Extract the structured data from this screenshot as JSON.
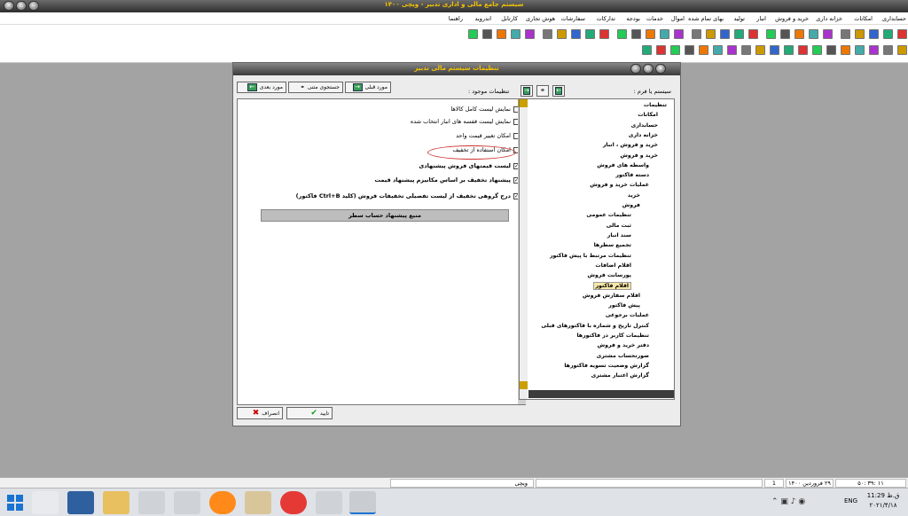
{
  "app": {
    "title": "سیستم جامع مالی و اداری تدبیر - ویچی ۱۴۰۰"
  },
  "menu": [
    "حسابداری",
    "امکانات",
    "خزانه داری",
    "خرید و فروش",
    "انبار",
    "تولید",
    "بهای تمام شده",
    "اموال",
    "خدمات",
    "بودجه",
    "تدارکات",
    "سفارشات",
    "هوش تجاری",
    "کارتابل",
    "اندروید",
    "راهنما"
  ],
  "dialog": {
    "title": "تنظیمات سیستم مالی تدبیر",
    "form_label": "سیستم یا فرم :",
    "settings_label": "تنظیمات موجود :",
    "prev_label": "مورد قبلی",
    "search_label": "جستجوی متنی",
    "next_label": "مورد بعدی",
    "options": [
      {
        "label": "نمایش لیست کامل کالاها",
        "checked": false,
        "bold": false
      },
      {
        "label": "نمایش لیست قفسه های انبار انتخاب شده",
        "checked": false,
        "bold": false
      },
      {
        "label": "امکان تغییر قیمت واحد",
        "checked": false,
        "bold": false
      },
      {
        "label": "امکان استفاده از تخفیف",
        "checked": false,
        "bold": false
      },
      {
        "label": "لیست قیمتهای فروش پیشنهادی",
        "checked": true,
        "bold": true
      },
      {
        "label": "پیشنهاد تخفیف بر اساس مکانیزم پیشنهاد قیمت",
        "checked": true,
        "bold": true
      },
      {
        "label": "درج گروهی تخفیف از لیست تفصیلی تخفیفات فروش (کلید Ctrl+B فاکتور)",
        "checked": true,
        "bold": true
      }
    ],
    "source_bar": "منبع پیشنهاد حساب سطر",
    "tree": [
      {
        "label": "تنظیمات",
        "level": 0
      },
      {
        "label": "امکانات",
        "level": 1
      },
      {
        "label": "حسابداری",
        "level": 1
      },
      {
        "label": "خزانه داری",
        "level": 1
      },
      {
        "label": "خرید و فروش ، انبار",
        "level": 1
      },
      {
        "label": "خرید و فروش",
        "level": 1
      },
      {
        "label": "واسطه های فروش",
        "level": 2
      },
      {
        "label": "دسته فاکتور",
        "level": 2
      },
      {
        "label": "عملیات خرید و فروش",
        "level": 2
      },
      {
        "label": "خرید",
        "level": 3
      },
      {
        "label": "فروش",
        "level": 3
      },
      {
        "label": "تنظیمات عمومی",
        "level": 4
      },
      {
        "label": "ثبت مالی",
        "level": 4
      },
      {
        "label": "سند انبار",
        "level": 4
      },
      {
        "label": "تجمیع سطرها",
        "level": 4
      },
      {
        "label": "تنظیمات مرتبط با پیش فاکتور",
        "level": 4
      },
      {
        "label": "اقلام اضافات",
        "level": 4
      },
      {
        "label": "پورسانت فروش",
        "level": 4
      },
      {
        "label": "اقلام فاکتور",
        "level": 4
      },
      {
        "label": "اقلام سفارش فروش",
        "level": 3
      },
      {
        "label": "پیش فاکتور",
        "level": 3
      },
      {
        "label": "عملیات برجوعی",
        "level": 2
      },
      {
        "label": "کنترل تاریخ و شماره با فاکتورهای قبلی",
        "level": 2
      },
      {
        "label": "تنظیمات کاربر در فاکتورها",
        "level": 2
      },
      {
        "label": "دفتر خرید و فروش",
        "level": 2
      },
      {
        "label": "صورتحساب مشتری",
        "level": 2
      },
      {
        "label": "گزارش وضعیت تسویه فاکتورها",
        "level": 2
      },
      {
        "label": "گزارش اعتبار مشتری",
        "level": 2
      }
    ],
    "confirm_label": "تایید",
    "cancel_label": "انصراف"
  },
  "status": {
    "time": "۵۰: ۳۹: ۱۱",
    "date": "۲۹ فروردین ۱۴۰۰",
    "num": "1",
    "company": "ویچی"
  },
  "taskbar": {
    "clock": "11:29 ق.ظ",
    "date": "۲۰۲۱/۴/۱۸",
    "lang": "ENG"
  }
}
